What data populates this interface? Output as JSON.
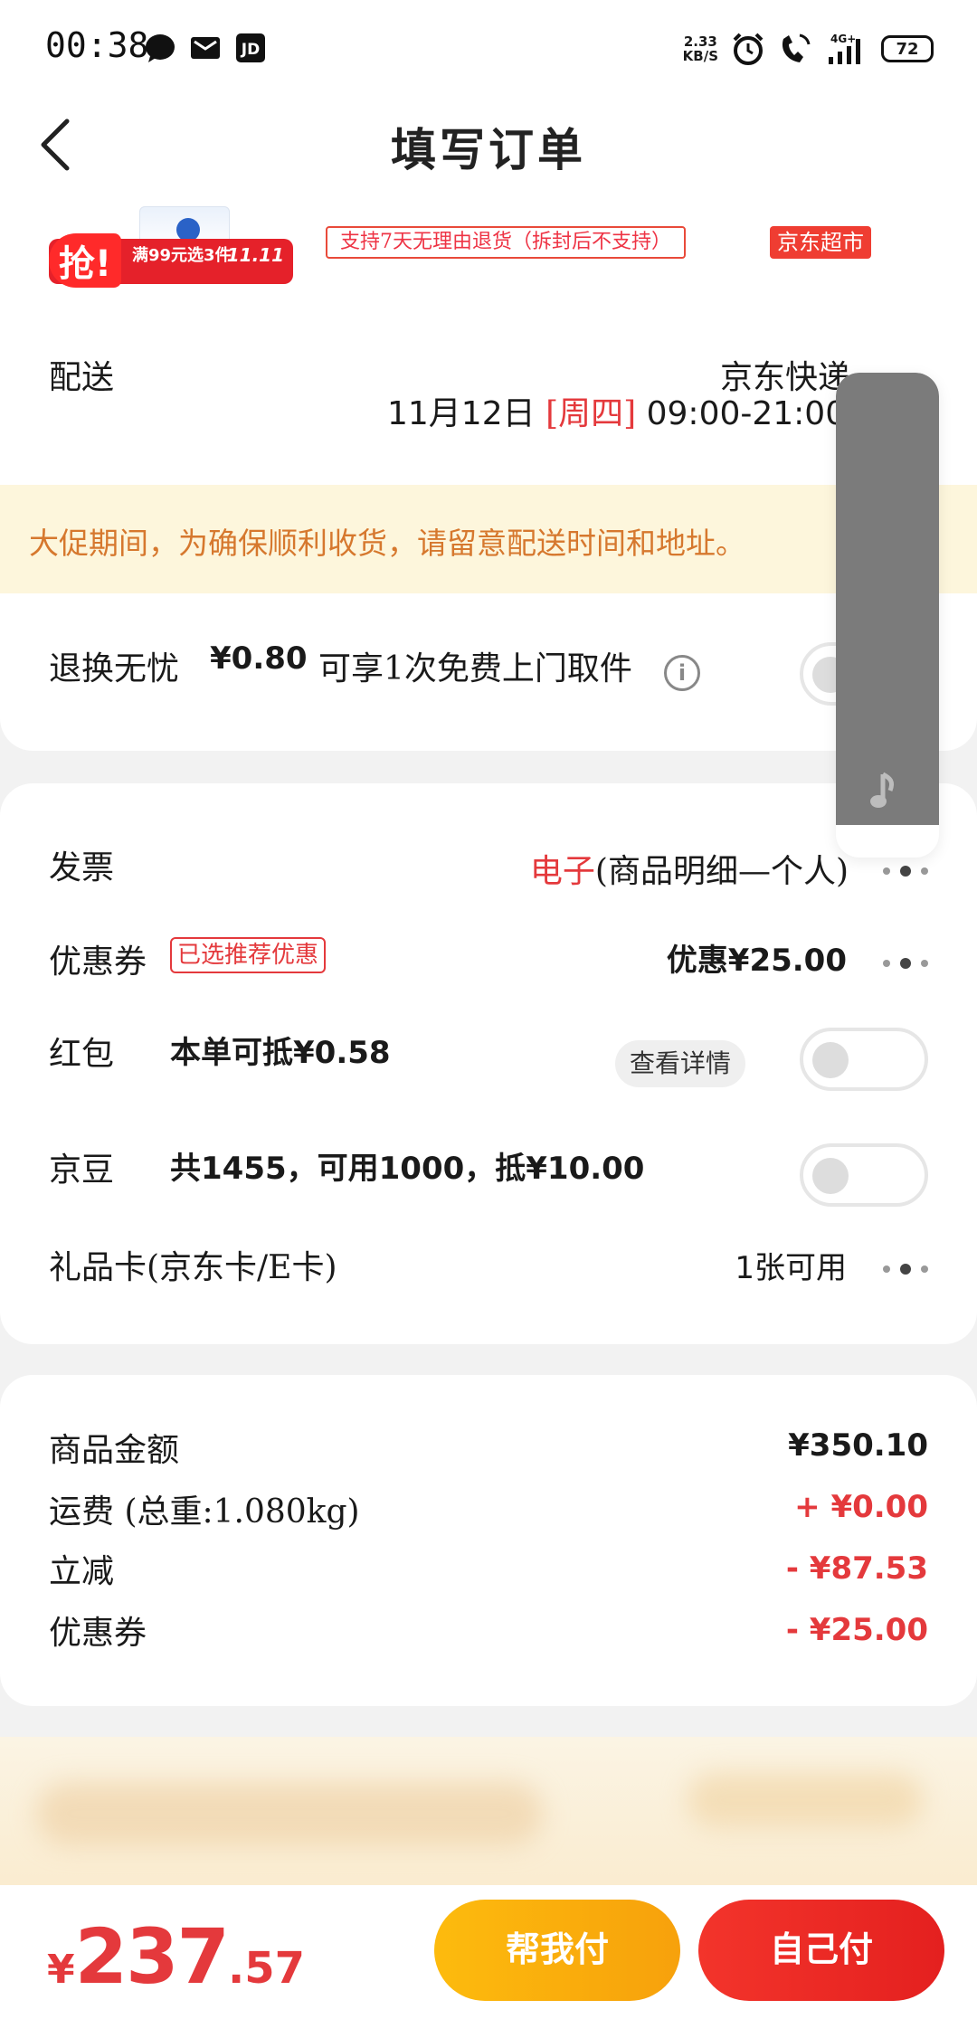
{
  "status_bar": {
    "time": "00:38",
    "net_speed_value": "2.33",
    "net_speed_unit": "KB/S",
    "network_type": "4G+",
    "battery": "72"
  },
  "header": {
    "title": "填写订单"
  },
  "promo_banner": {
    "badge": "抢!",
    "text": "满99元选3件",
    "event": "11.11"
  },
  "tags": {
    "return_policy": "支持7天无理由退货（拆封后不支持）",
    "store": "京东超市"
  },
  "delivery": {
    "label": "配送",
    "carrier": "京东快递",
    "date": "11月12日",
    "weekday": "[周四]",
    "time_range": "09:00-21:00"
  },
  "notice": {
    "text": "大促期间，为确保顺利收货，请留意配送时间和地址。"
  },
  "return_insurance": {
    "label": "退换无忧",
    "price": "¥0.80",
    "desc": "可享1次免费上门取件",
    "enabled": false
  },
  "invoice": {
    "label": "发票",
    "type": "电子",
    "detail": "(商品明细—个人)"
  },
  "coupon": {
    "label": "优惠券",
    "tag": "已选推荐优惠",
    "value": "优惠¥25.00"
  },
  "red_packet": {
    "label": "红包",
    "desc": "本单可抵¥0.58",
    "detail_button": "查看详情",
    "enabled": false
  },
  "jd_beans": {
    "label": "京豆",
    "desc": "共1455，可用1000，抵¥10.00",
    "enabled": false
  },
  "gift_card": {
    "label": "礼品卡(京东卡/E卡)",
    "value": "1张可用"
  },
  "summary": {
    "items": [
      {
        "label": "商品金额",
        "value": "¥350.10"
      },
      {
        "label": "运费 (总重:1.080kg)",
        "value": "+ ¥0.00"
      },
      {
        "label": "立减",
        "value": "- ¥87.53"
      },
      {
        "label": "优惠券",
        "value": "- ¥25.00"
      }
    ]
  },
  "footer": {
    "currency": "¥",
    "total_int": "237",
    "total_dec": ".57",
    "help_pay": "帮我付",
    "self_pay": "自己付"
  },
  "colors": {
    "accent_red": "#e4393c",
    "notice_bg": "#fdf6dc",
    "notice_text": "#d6782e",
    "help_btn": "#fdbb0d"
  }
}
